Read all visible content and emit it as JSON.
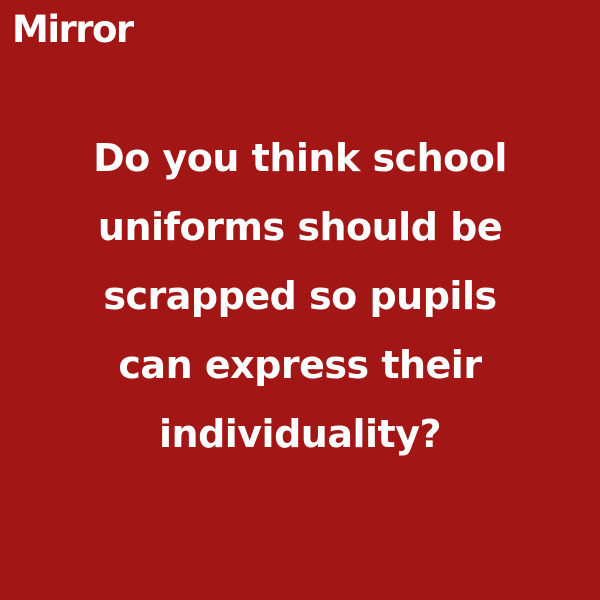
{
  "brand": {
    "logo_text": "Mirror"
  },
  "post": {
    "question_lines": [
      "Do you think school",
      "uniforms should be",
      "scrapped so pupils",
      "can express their",
      "individuality?"
    ]
  },
  "colors": {
    "background": "#a31616",
    "text": "#ffffff"
  }
}
